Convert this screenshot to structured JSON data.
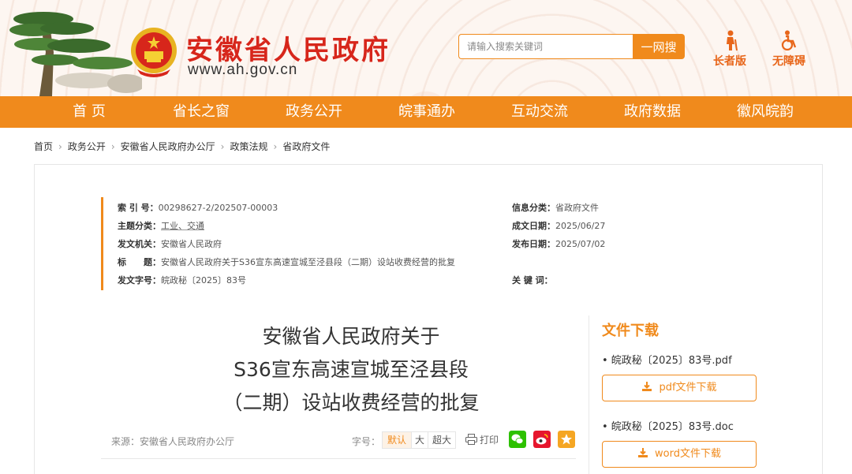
{
  "header": {
    "site_title": "安徽省人民政府",
    "site_url": "www.ah.gov.cn",
    "search_placeholder": "请输入搜索关键词",
    "search_button": "一网搜",
    "elder_label": "长者版",
    "access_label": "无障碍"
  },
  "nav": {
    "items": [
      "首 页",
      "省长之窗",
      "政务公开",
      "皖事通办",
      "互动交流",
      "政府数据",
      "徽风皖韵"
    ]
  },
  "breadcrumb": [
    "首页",
    "政务公开",
    "安徽省人民政府办公厅",
    "政策法规",
    "省政府文件"
  ],
  "meta": {
    "index_label": "索 引 号：",
    "index_value": "00298627-2/202507-00003",
    "info_cat_label": "信息分类：",
    "info_cat_value": "省政府文件",
    "topic_label": "主题分类：",
    "topic_value": "工业、交通",
    "created_label": "成文日期：",
    "created_value": "2025/06/27",
    "issuer_label": "发文机关：",
    "issuer_value": "安徽省人民政府",
    "published_label": "发布日期：",
    "published_value": "2025/07/02",
    "title_label": "标　　题：",
    "title_value": "安徽省人民政府关于S36宣东高速宣城至泾县段（二期）设站收费经营的批复",
    "docno_label": "发文字号：",
    "docno_value": "皖政秘〔2025〕83号",
    "keywords_label": "关 键 词："
  },
  "document": {
    "title_line1": "安徽省人民政府关于",
    "title_line2": "S36宣东高速宣城至泾县段",
    "title_line3": "（二期）设站收费经营的批复",
    "source": "来源：安徽省人民政府办公厅",
    "font_size_label": "字号：",
    "font_default": "默认",
    "font_large": "大",
    "font_xlarge": "超大",
    "print_label": "打印"
  },
  "downloads": {
    "title": "文件下载",
    "pdf_name": "• 皖政秘〔2025〕83号.pdf",
    "pdf_button": "pdf文件下载",
    "doc_name": "• 皖政秘〔2025〕83号.doc",
    "word_button": "word文件下载"
  },
  "colors": {
    "accent": "#f08a1c",
    "title_red": "#d7261b",
    "wechat": "#2dc100",
    "weibo": "#e6162d",
    "favorite": "#f5a623"
  }
}
